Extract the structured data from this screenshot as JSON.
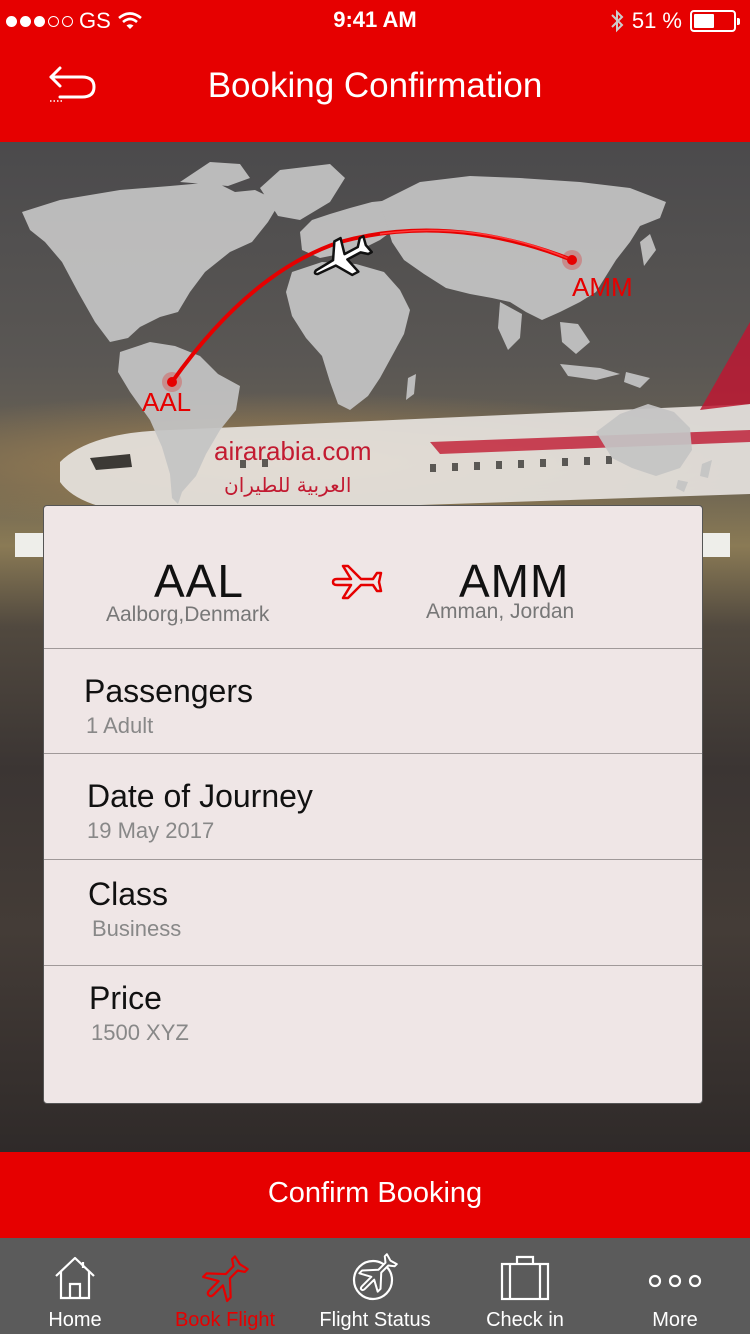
{
  "status": {
    "carrier": "GS",
    "time": "9:41 AM",
    "battery": "51 %"
  },
  "header": {
    "title": "Booking Confirmation",
    "back_icon": "back-arrow-icon"
  },
  "map": {
    "origin_label": "AAL",
    "dest_label": "AMM",
    "logo_en": "airarabia.com",
    "logo_ar": "العربية للطيران"
  },
  "route": {
    "from_code": "AAL",
    "from_city": "Aalborg,Denmark",
    "to_code": "AMM",
    "to_city": "Amman, Jordan"
  },
  "details": {
    "passengers_label": "Passengers",
    "passengers_value": "1 Adult",
    "date_label": "Date of Journey",
    "date_value": "19 May 2017",
    "class_label": "Class",
    "class_value": "Business",
    "price_label": "Price",
    "price_value": "1500 XYZ"
  },
  "confirm_label": "Confirm Booking",
  "tabs": [
    {
      "label": "Home",
      "icon": "home-icon"
    },
    {
      "label": "Book Flight",
      "icon": "airplane-icon"
    },
    {
      "label": "Flight Status",
      "icon": "flight-status-icon"
    },
    {
      "label": "Check in",
      "icon": "luggage-icon"
    },
    {
      "label": "More",
      "icon": "more-dots-icon"
    }
  ],
  "colors": {
    "brand_red": "#e60000",
    "card_bg": "#efe6e6",
    "tabbar_bg": "#5b5b5b"
  }
}
